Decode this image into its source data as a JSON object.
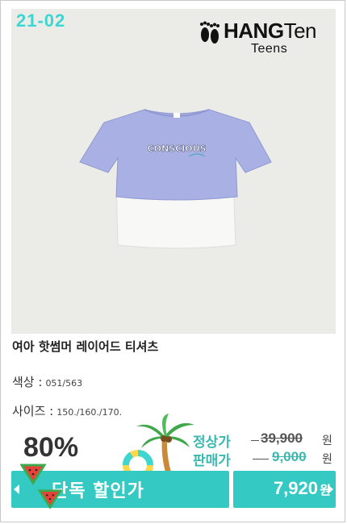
{
  "product": {
    "code": "21-02",
    "brand_main": "HANG",
    "brand_thin": "Ten",
    "brand_sub": "Teens",
    "shirt_print": "CONSCIOUS",
    "name": "여아 핫썸머 레이어드 티셔츠",
    "color_label": "색상 :",
    "color_value": "051/563",
    "size_label": "사이즈 :",
    "size_value": "150./160./170."
  },
  "pricing": {
    "discount": "80%",
    "regular_label": "정상가",
    "regular_price": "39,900",
    "sale_label": "판매가",
    "sale_price": "9,000",
    "currency": "원",
    "exclusive_label": "단독 할인가",
    "exclusive_price": "7,920",
    "exclusive_currency": "원"
  },
  "colors": {
    "accent": "#35c9c4",
    "code": "#3dd6d0",
    "shirt_top": "#a8b0e4",
    "shirt_bottom": "#f8f8f6"
  },
  "icons": [
    "feet-logo-icon",
    "watermelon-icon",
    "palm-tree-icon",
    "swim-ring-icon"
  ]
}
